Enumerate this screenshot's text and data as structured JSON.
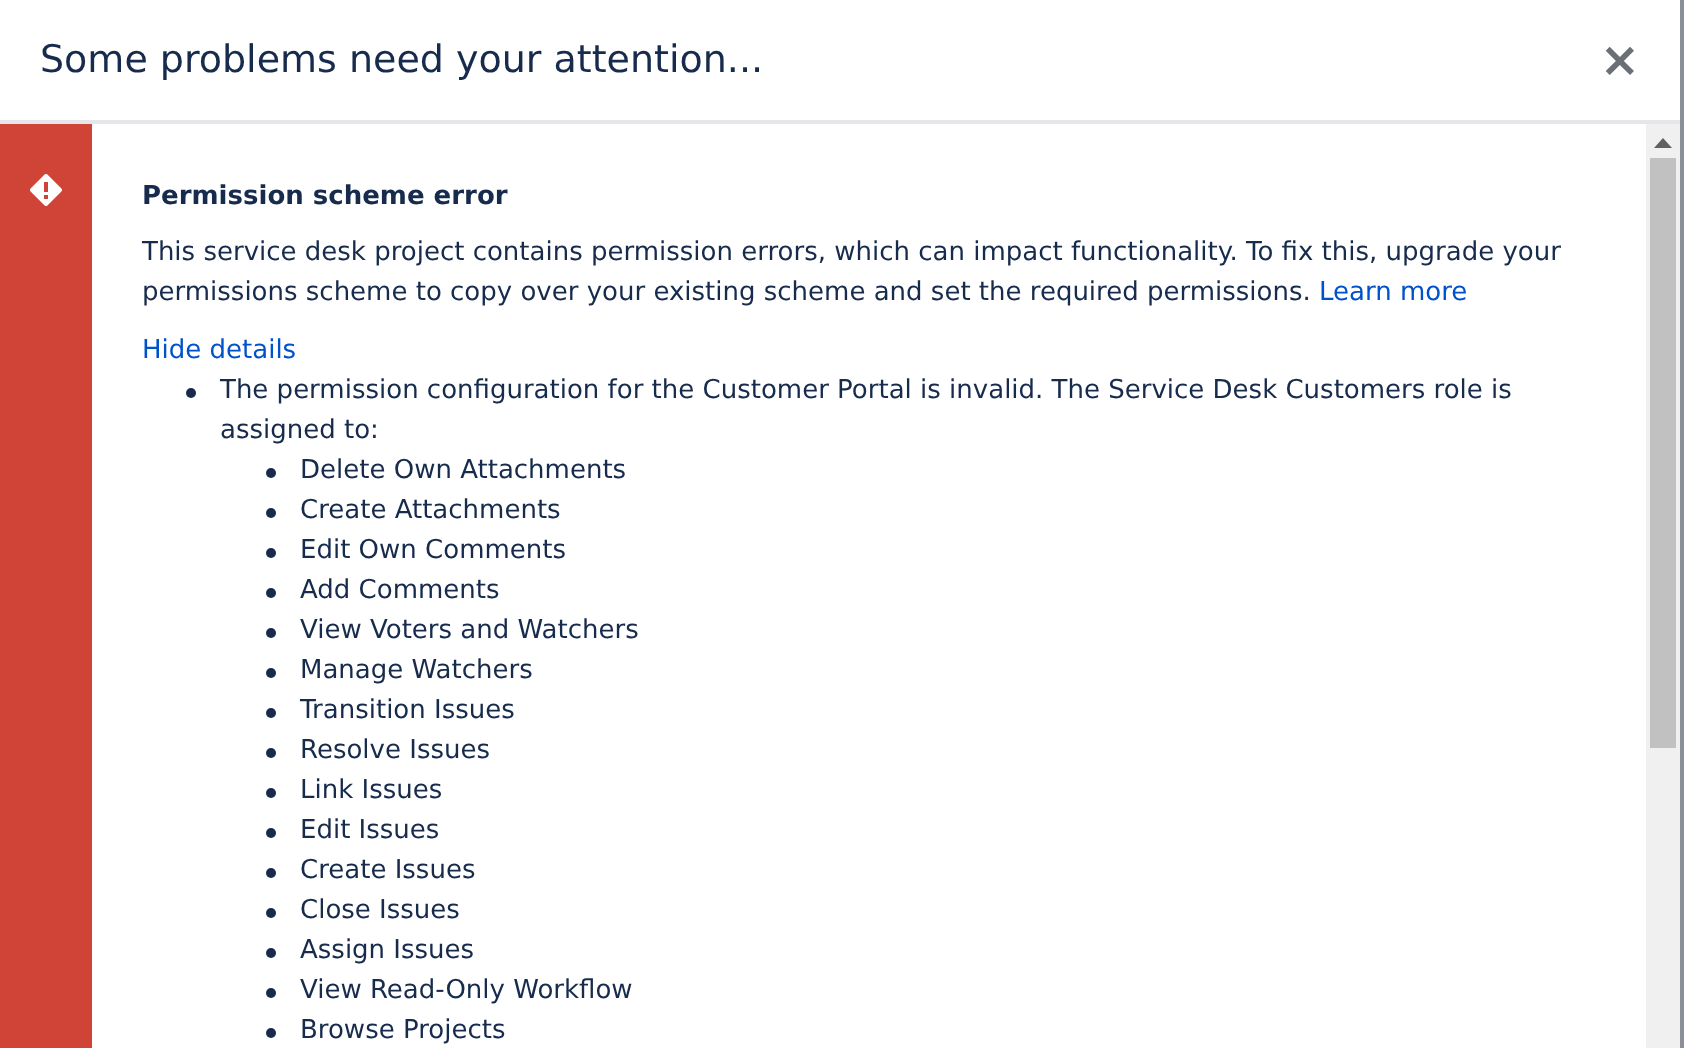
{
  "dialog": {
    "title": "Some problems need your attention...",
    "close": "×"
  },
  "message": {
    "title": "Permission scheme error",
    "text": "This service desk project contains permission errors, which can impact functionality. To fix this, upgrade your permissions scheme to copy over your existing scheme and set the required permissions.",
    "link": "Learn more",
    "details_toggle": "Hide details",
    "details": [
      {
        "text": "The permission configuration for the Customer Portal is invalid. The Service Desk Customers role is assigned to:",
        "children": [
          {
            "text": "Delete Own Attachments"
          },
          {
            "text": "Create Attachments"
          },
          {
            "text": "Edit Own Comments"
          },
          {
            "text": "Add Comments"
          },
          {
            "text": "View Voters and Watchers"
          },
          {
            "text": "Manage Watchers"
          },
          {
            "text": "Transition Issues"
          },
          {
            "text": "Resolve Issues"
          },
          {
            "text": "Link Issues"
          },
          {
            "text": "Edit Issues"
          },
          {
            "text": "Create Issues"
          },
          {
            "text": "Close Issues"
          },
          {
            "text": "Assign Issues"
          },
          {
            "text": "View Read-Only Workflow"
          },
          {
            "text": "Browse Projects"
          }
        ]
      }
    ]
  }
}
